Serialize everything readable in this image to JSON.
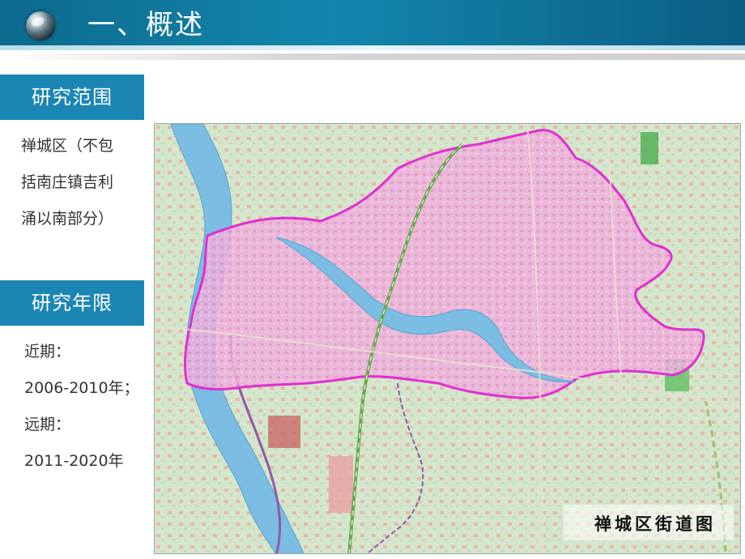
{
  "header": {
    "title": "一、概述"
  },
  "scope": {
    "label": "研究范围",
    "lines": [
      "禅城区（不包",
      "括南庄镇吉利",
      "涌以南部分）"
    ]
  },
  "period": {
    "label": "研究年限",
    "lines": [
      "近期：",
      "2006-2010年；",
      "远期：",
      "2011-2020年"
    ]
  },
  "map": {
    "caption": "禅城区街道图"
  },
  "colors": {
    "header": "#1386ad",
    "label_bg": "#1b86b3",
    "district_fill": "#f2b3e4",
    "district_border": "#e033d6",
    "river": "#6fb7e0"
  }
}
